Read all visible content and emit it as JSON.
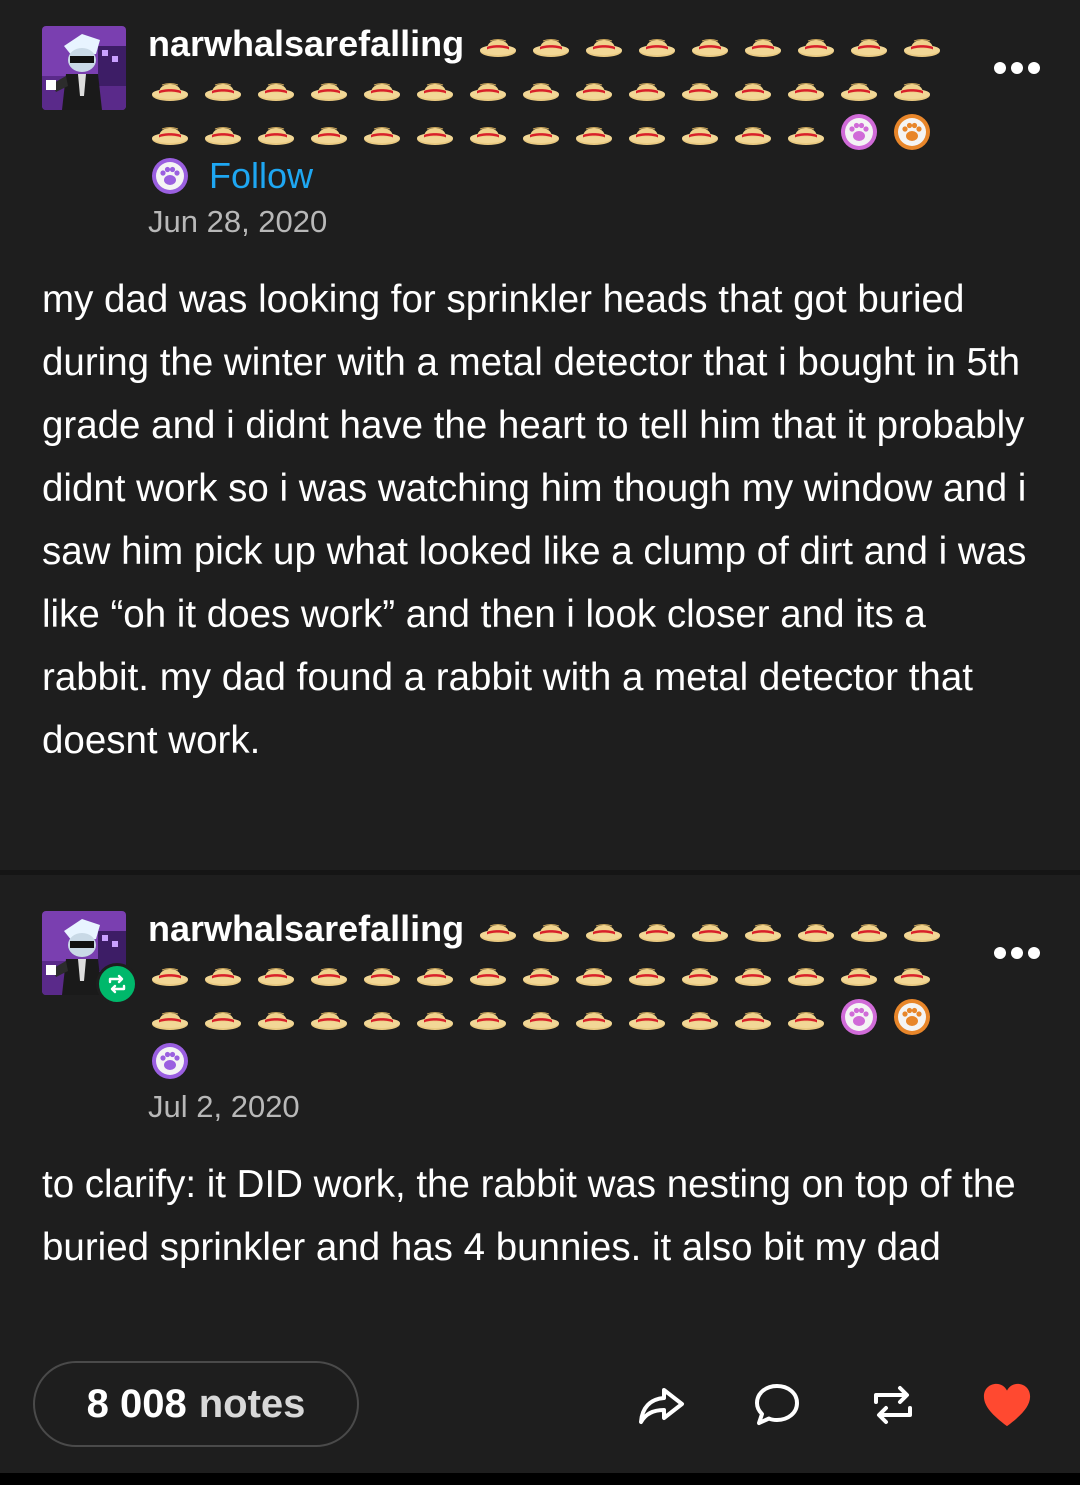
{
  "post": {
    "username": "narwhalsarefalling",
    "follow_label": "Follow",
    "date": "Jun 28, 2020",
    "body": "my dad was looking for sprinkler heads that got buried during the winter with a metal detector that i bought in 5th grade and i didnt have the heart to tell him that it probably didnt work so i was watching him though my window and i saw him pick up what looked like a clump of dirt and i was like “oh it does work” and then i look closer and its a rabbit. my dad found a rabbit with a metal detector that doesnt work."
  },
  "reblog": {
    "username": "narwhalsarefalling",
    "date": "Jul 2, 2020",
    "body": "to clarify: it DID work, the rabbit was nesting on top of the buried sprinkler and has 4 bunnies. it also bit my dad"
  },
  "name_decorations": {
    "hat_emoji_count": 37,
    "hat_icon": "straw-hat-emoji",
    "paw_badges": [
      {
        "icon": "paw-badge-pink",
        "color": "#d06bd8"
      },
      {
        "icon": "paw-badge-orange",
        "color": "#e8862a"
      },
      {
        "icon": "paw-badge-purple",
        "color": "#9a5fe0"
      }
    ]
  },
  "footer": {
    "notes_count": "8 008",
    "notes_label": "notes",
    "actions": [
      "share-icon",
      "reply-icon",
      "reblog-icon",
      "like-heart-icon"
    ],
    "like_color": "#ff4930"
  },
  "colors": {
    "background": "#1e1e1e",
    "follow_link": "#1ea7f2",
    "reblog_badge": "#00b86b"
  }
}
